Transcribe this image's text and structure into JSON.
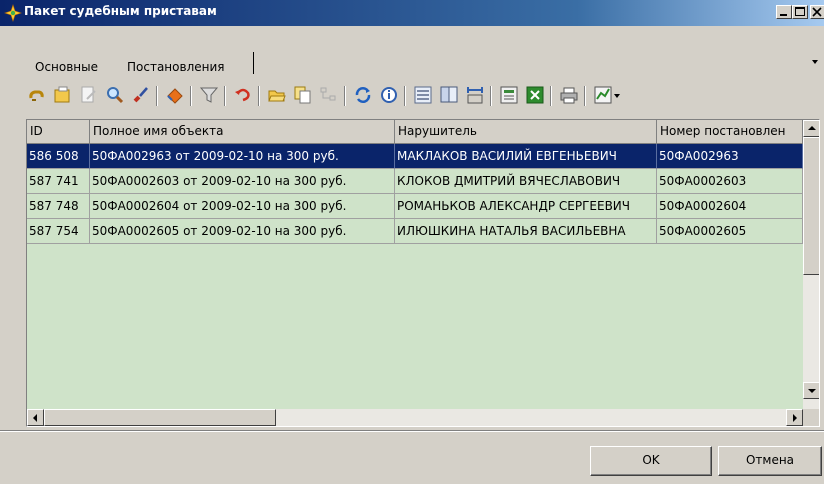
{
  "window": {
    "title": "Пакет судебным приставам",
    "colors": {
      "titlebar": "#0a246a",
      "face": "#d4d0c8",
      "grid_bg": "#cfe3c9",
      "selection": "#0a246a"
    }
  },
  "tabs": [
    {
      "label": "Основные",
      "active": false
    },
    {
      "label": "Постановления",
      "active": true
    }
  ],
  "toolbar": {
    "icons": [
      "link-icon",
      "folder-icon",
      "edit-doc-icon",
      "search-icon",
      "brush-icon",
      "eraser-icon",
      "filter-icon",
      "undo-icon",
      "open-folder-icon",
      "copy-doc-icon",
      "tree-icon",
      "refresh-icon",
      "info-icon",
      "list-icon",
      "report-icon",
      "columns-icon",
      "notes-icon",
      "excel-icon",
      "print-icon",
      "chart-dropdown-icon"
    ]
  },
  "grid": {
    "columns": [
      "ID",
      "Полное имя объекта",
      "Нарушитель",
      "Номер постановлен"
    ],
    "rows": [
      {
        "id": "586 508",
        "name": "50ФА002963 от 2009-02-10 на 300 руб.",
        "violator": "МАКЛАКОВ ВАСИЛИЙ ЕВГЕНЬЕВИЧ",
        "number": "50ФА002963",
        "selected": true
      },
      {
        "id": "587 741",
        "name": "50ФА0002603 от 2009-02-10 на 300 руб.",
        "violator": "КЛОКОВ ДМИТРИЙ ВЯЧЕСЛАВОВИЧ",
        "number": "50ФА0002603",
        "selected": false
      },
      {
        "id": "587 748",
        "name": "50ФА0002604 от 2009-02-10 на 300 руб.",
        "violator": "РОМАНЬКОВ АЛЕКСАНДР СЕРГЕЕВИЧ",
        "number": "50ФА0002604",
        "selected": false
      },
      {
        "id": "587 754",
        "name": "50ФА0002605 от 2009-02-10 на 300 руб.",
        "violator": "ИЛЮШКИНА НАТАЛЬЯ ВАСИЛЬЕВНА",
        "number": "50ФА0002605",
        "selected": false
      }
    ]
  },
  "footer": {
    "ok_label": "OK",
    "cancel_label": "Отмена"
  }
}
